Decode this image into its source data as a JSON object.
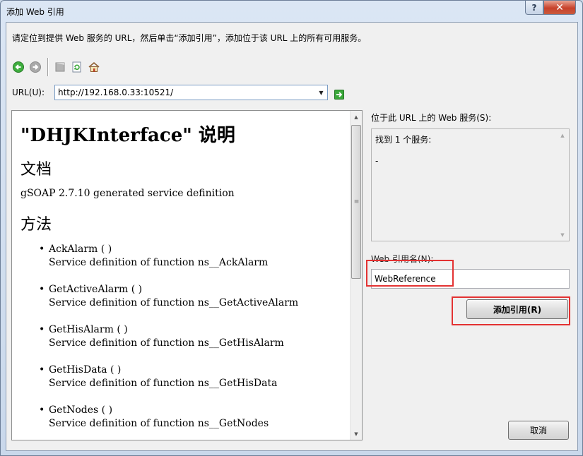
{
  "window": {
    "title": "添加 Web 引用",
    "help_label": "?",
    "close_label": "✕"
  },
  "description": "请定位到提供 Web 服务的 URL，然后单击“添加引用”，添加位于该 URL 上的所有可用服务。",
  "toolbar": {
    "icons": [
      "back-icon",
      "forward-icon",
      "stop-icon",
      "refresh-icon",
      "home-icon"
    ]
  },
  "url": {
    "label": "URL(U):",
    "value": "http://192.168.0.33:10521/"
  },
  "doc": {
    "title": "\"DHJKInterface\" 说明",
    "section_doc": "文档",
    "doc_text": "gSOAP 2.7.10 generated service definition",
    "section_methods": "方法",
    "methods": [
      {
        "name": "AckAlarm ( )",
        "desc": "Service definition of function ns__AckAlarm"
      },
      {
        "name": "GetActiveAlarm ( )",
        "desc": "Service definition of function ns__GetActiveAlarm"
      },
      {
        "name": "GetHisAlarm ( )",
        "desc": "Service definition of function ns__GetHisAlarm"
      },
      {
        "name": "GetHisData ( )",
        "desc": "Service definition of function ns__GetHisData"
      },
      {
        "name": "GetNodes ( )",
        "desc": "Service definition of function ns__GetNodes"
      }
    ]
  },
  "services": {
    "label": "位于此 URL 上的 Web 服务(S):",
    "found": "找到 1 个服务:",
    "item": "-"
  },
  "reference": {
    "label": "Web 引用名(N):",
    "value": "WebReference",
    "add_button": "添加引用(R)"
  },
  "cancel_button": "取消",
  "colors": {
    "highlight_red": "#e33232",
    "go_green": "#3aa83a"
  }
}
